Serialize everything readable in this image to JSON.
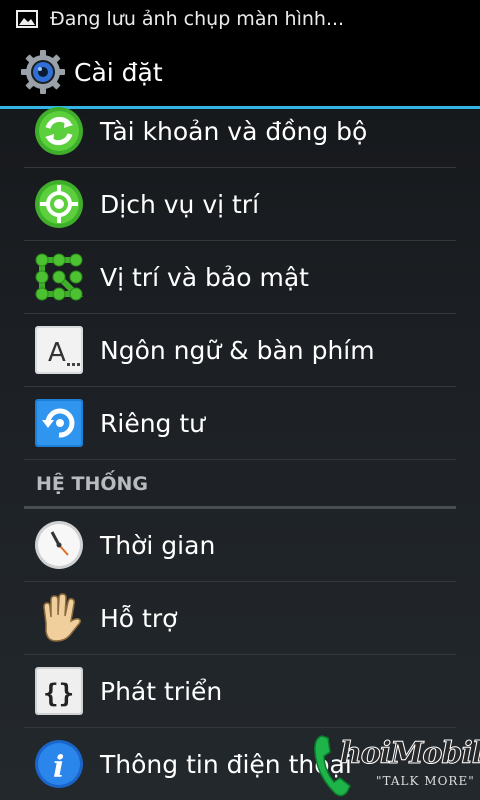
{
  "status_bar": {
    "notification_text": "Đang lưu ảnh chụp màn hình..."
  },
  "action_bar": {
    "title": "Cài đặt",
    "accent_color": "#33b5e5"
  },
  "items": [
    {
      "label": "Tài khoản và đồng bộ",
      "icon": "sync-icon"
    },
    {
      "label": "Dịch vụ vị trí",
      "icon": "location-target-icon"
    },
    {
      "label": "Vị trí và bảo mật",
      "icon": "pattern-lock-icon"
    },
    {
      "label": "Ngôn ngữ & bàn phím",
      "icon": "keyboard-language-icon"
    },
    {
      "label": "Riêng tư",
      "icon": "backup-restore-icon"
    }
  ],
  "section_header": "HỆ THỐNG",
  "system_items": [
    {
      "label": "Thời gian",
      "icon": "clock-icon"
    },
    {
      "label": "Hỗ trợ",
      "icon": "hand-icon"
    },
    {
      "label": "Phát triển",
      "icon": "braces-icon"
    },
    {
      "label": "Thông tin điện thoại",
      "icon": "info-icon"
    }
  ],
  "watermark": {
    "brand": "hoiMobile",
    "tagline": "\"TALK MORE\""
  }
}
